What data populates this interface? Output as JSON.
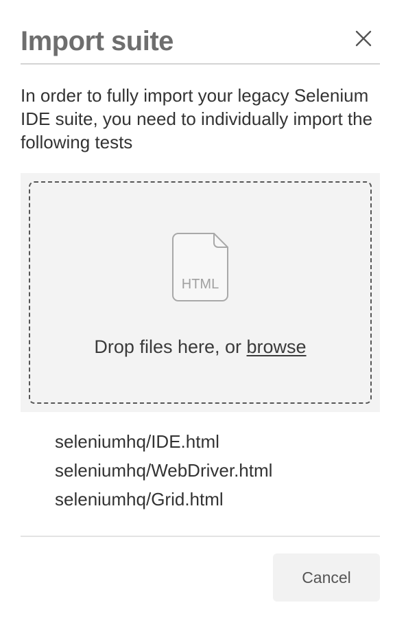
{
  "dialog": {
    "title": "Import suite",
    "close_icon": "close-icon",
    "description": "In order to fully import your legacy Selenium IDE suite, you need to individually import the following tests",
    "dropzone": {
      "file_icon": "html-file-icon",
      "file_icon_label": "HTML",
      "prompt": "Drop files here, or ",
      "browse_label": "browse"
    },
    "files": [
      "seleniumhq/IDE.html",
      "seleniumhq/WebDriver.html",
      "seleniumhq/Grid.html"
    ],
    "cancel_label": "Cancel"
  },
  "colors": {
    "title": "#6e6e6e",
    "text": "#333333",
    "dropzone_background": "#f3f3f3",
    "button_background": "#f2f2f2"
  }
}
